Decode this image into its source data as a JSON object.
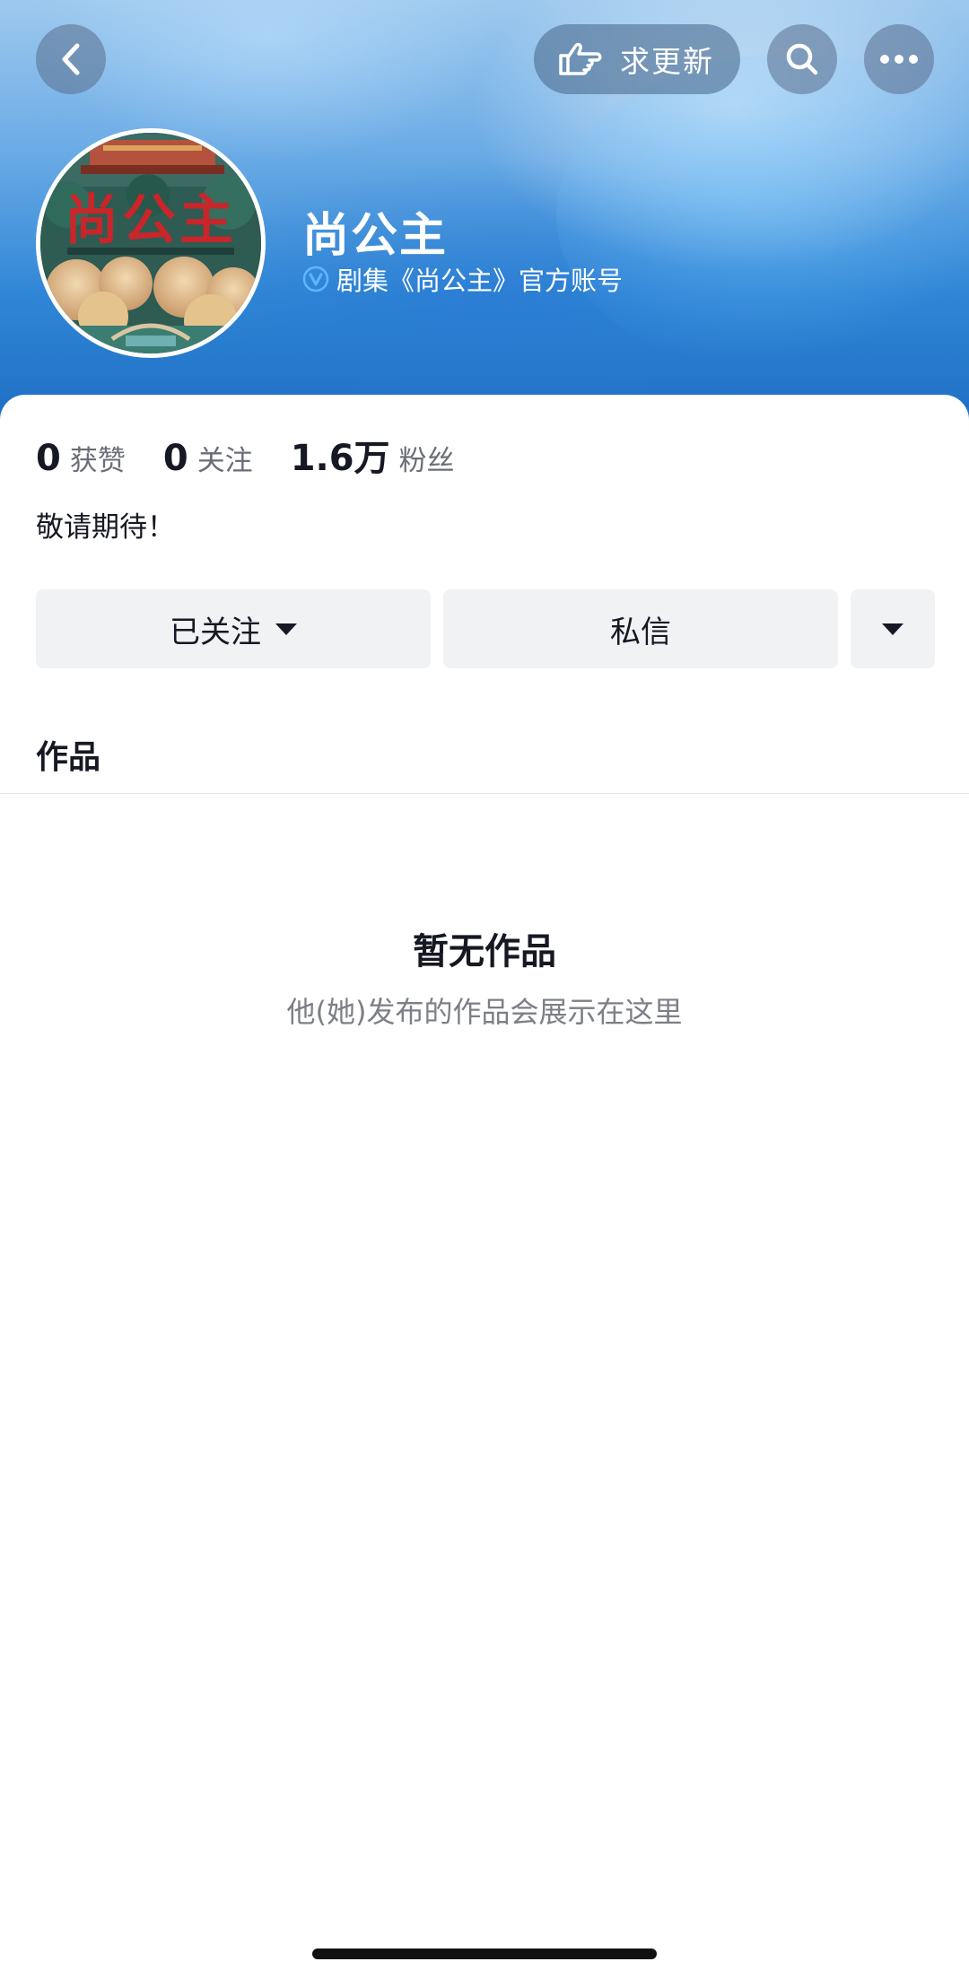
{
  "header": {
    "update_button_label": "求更新"
  },
  "profile": {
    "name": "尚公主",
    "avatar_text": "尚公主",
    "verification_text": "剧集《尚公主》官方账号"
  },
  "stats": [
    {
      "value": "0",
      "label": "获赞"
    },
    {
      "value": "0",
      "label": "关注"
    },
    {
      "value": "1.6万",
      "label": "粉丝"
    }
  ],
  "bio": "敬请期待！",
  "actions": {
    "follow_label": "已关注",
    "message_label": "私信"
  },
  "tabs": {
    "works_label": "作品"
  },
  "empty_state": {
    "title": "暂无作品",
    "subtitle": "他(她)发布的作品会展示在这里"
  },
  "colors": {
    "banner_top": "#9ec9ee",
    "banner_bottom": "#1f6fc4",
    "verify_badge": "#5fb6ff",
    "button_bg": "#f1f2f4"
  },
  "icons": [
    "back-icon",
    "pointing-hand-icon",
    "search-icon",
    "more-icon",
    "verified-icon",
    "caret-down-icon"
  ]
}
